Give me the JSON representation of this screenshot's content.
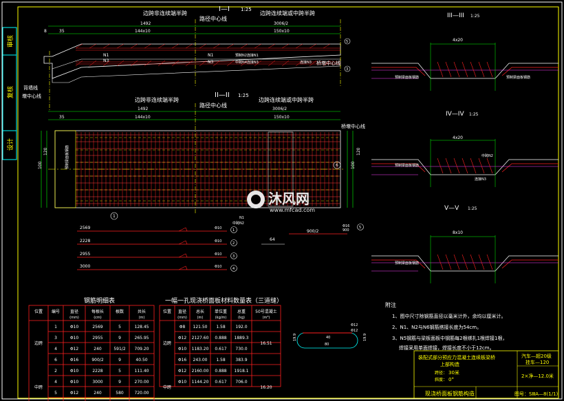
{
  "left_stamps": [
    "审核",
    "复核",
    "设计"
  ],
  "section_I": {
    "label": "I—I",
    "scale": "1:25"
  },
  "plan_II": {
    "label": "II—II",
    "scale": "1:25"
  },
  "section_III": {
    "label": "III—III",
    "scale": "1:25"
  },
  "section_IV": {
    "label": "IV—IV",
    "scale": "1:25"
  },
  "section_V": {
    "label": "V—V",
    "scale": "1:25"
  },
  "annot": {
    "side_span": "边跨非连续端半跨",
    "pier_center": "路径中心线",
    "cont_span": "边跨连续端或中跨半跨",
    "bridge_center": "桥墩中心线",
    "abut_center": "背墙线",
    "cross_center": "墩中心线",
    "dims": {
      "d1492": "1492",
      "d144x10": "144x10",
      "d150x10": "150x10",
      "d3006": "3006/2",
      "d35": "35",
      "d8": "8",
      "d6": "6",
      "d4x20": "4x20",
      "d8x10": "8x10",
      "d100": "100",
      "d120": "120",
      "d64": "64",
      "d900": "900/2"
    },
    "bars": {
      "n1": "N1",
      "n2": "N2",
      "n3": "N3",
      "n4": "N4"
    },
    "notes_small": [
      "预制N2连接N1",
      "中跨N4连接N3",
      "连接N3",
      "中跨N2"
    ],
    "slab_labels": [
      "预制梁面板钢筋",
      "预制梁面板钢筋",
      "预制梁面板钢筋",
      "预制梁面板钢筋",
      "预制梁面板钢筋"
    ]
  },
  "bar_shapes": [
    {
      "id": "1",
      "len": "2569",
      "dia": "Φ10"
    },
    {
      "id": "2",
      "len": "2228",
      "dia": "Φ10"
    },
    {
      "id": "3",
      "len": "2955",
      "dia": "Φ10"
    },
    {
      "id": "4",
      "len": "3000",
      "dia": "Φ10"
    },
    {
      "id": "5",
      "len": "900",
      "dia": "Φ16"
    }
  ],
  "hook_detail": {
    "dia1": "Φ12",
    "dia2": "Φ12",
    "w40": "40",
    "w80": "80",
    "h": "19.9"
  },
  "rebar_table": {
    "title": "钢筋明细表",
    "headers": [
      "位置",
      "编号",
      "直径",
      "每根长",
      "根数",
      "共长"
    ],
    "units": [
      "",
      "",
      "(mm)",
      "(cm)",
      "",
      "(m)"
    ],
    "rows": [
      [
        "边跨",
        "1",
        "Φ10",
        "2569",
        "5",
        "128.45"
      ],
      [
        "",
        "3",
        "Φ10",
        "2955",
        "9",
        "265.95"
      ],
      [
        "",
        "4",
        "Φ12",
        "240",
        "591/2",
        "709.20"
      ],
      [
        "",
        "6",
        "Φ16",
        "900/2",
        "9",
        "40.50"
      ],
      [
        "中跨",
        "2",
        "Φ10",
        "2228",
        "5",
        "111.40"
      ],
      [
        "",
        "4",
        "Φ10",
        "3000",
        "9",
        "270.00"
      ],
      [
        "",
        "5",
        "Φ12",
        "240",
        "580",
        "720.00"
      ],
      [
        "",
        "6",
        "Φ16",
        "900",
        "9",
        "81.00"
      ]
    ]
  },
  "material_table": {
    "title": "一幅一孔现浇桥面板材料数量表（三道缝）",
    "headers": [
      "位置",
      "直径",
      "总长",
      "单位重",
      "总重",
      "50号混凝土"
    ],
    "units": [
      "",
      "(mm)",
      "(m)",
      "(kg/m)",
      "(kg)",
      "(m³)"
    ],
    "rows": [
      [
        "边跨",
        "Φ8",
        "121.50",
        "1.58",
        "192.0",
        "16.51"
      ],
      [
        "",
        "Φ12",
        "2127.60",
        "0.888",
        "1889.3",
        ""
      ],
      [
        "",
        "Φ10",
        "1183.20",
        "0.617",
        "730.0",
        ""
      ],
      [
        "",
        "Φ16",
        "243.00",
        "1.58",
        "383.9",
        ""
      ],
      [
        "中跨",
        "Φ12",
        "2160.00",
        "0.888",
        "1918.1",
        "16.20"
      ],
      [
        "",
        "Φ10",
        "1144.20",
        "0.617",
        "706.0",
        ""
      ]
    ]
  },
  "notes": {
    "title": "附注",
    "items": [
      "1、图中尺寸除钢筋直径以毫米计外，余均以厘米计。",
      "2、N1、N2与N6钢筋搭接长度为54cm。",
      "3、N5钢筋与梁板面板中钢筋每2根绑扎1根焊接1根，",
      "焊接采用单面焊接，焊接长度不小于12cm。"
    ]
  },
  "title_block": {
    "project": "装配式部分预应力混凝土连续板梁桥上部构造",
    "load": "汽车—超20级",
    "load2": "挂车—120",
    "span_label": "跨径：",
    "span": "30米",
    "skew_label": "斜度：",
    "skew": "0°",
    "width": "2×净—12.0米",
    "drawing": "现浇桥面板钢筋构造",
    "number": "图号：SⅢA—8(1/1)"
  },
  "watermark": {
    "name": "沐风网",
    "url": "www.mfcad.com"
  }
}
